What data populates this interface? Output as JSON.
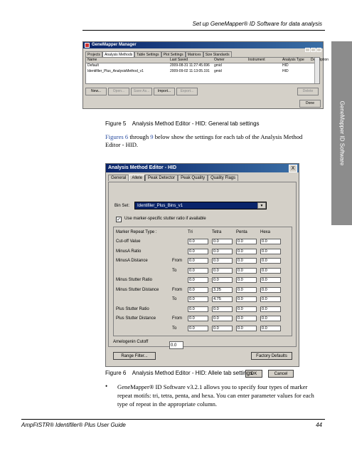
{
  "page": {
    "header": "Set up GeneMapper® ID Software for data analysis",
    "side_tab": "GeneMapper ID Software",
    "footer_left": "AmpFℓSTR® Identifiler® Plus User Guide",
    "footer_right": "44"
  },
  "manager": {
    "title": "GeneMapper Manager",
    "tabs": [
      "Projects",
      "Analysis Methods",
      "Table Settings",
      "Plot Settings",
      "Matrices",
      "Size Standards"
    ],
    "columns": [
      "Name",
      "Last Saved",
      "Owner",
      "Instrument",
      "Analysis Type",
      "Description"
    ],
    "rows": [
      [
        "Default",
        "2009-08-31 11:27:45.696",
        "gmid",
        "",
        "HID",
        ""
      ],
      [
        "Identifiler_Plus_AnalysisMethod_v1",
        "2009-09-02 11:13:05.191",
        "gmid",
        "",
        "HID",
        ""
      ]
    ],
    "buttons": [
      "New...",
      "Open...",
      "Save As...",
      "Import...",
      "Export...",
      "Delete"
    ],
    "done": "Done"
  },
  "figure5_caption": "Figure 5    Analysis Method Editor - HID: General tab settings",
  "para1": {
    "a": "Figures 6",
    "b": " through ",
    "c": "9",
    "d": " below show the settings for each tab of the Analysis Method Editor - HID."
  },
  "editor": {
    "title": "Analysis Method Editor - HID",
    "close": "X",
    "tabs": [
      "General",
      "Allele",
      "Peak Detector",
      "Peak Quality",
      "Quality Flags"
    ],
    "bin_set_label": "Bin Set:",
    "bin_set_value": "Identifiler_Plus_Bins_v1",
    "checkbox_label": "Use marker-specific stutter ratio if available",
    "checkbox_checked": "✓",
    "header_label": "Marker Repeat Type :",
    "col_heads": [
      "Tri",
      "Tetra",
      "Penta",
      "Hexa"
    ],
    "rows": [
      {
        "label": "Cut-off Value",
        "sub": "",
        "vals": [
          "0.0",
          "0.0",
          "0.0",
          "0.0"
        ]
      },
      {
        "label": "MinusA Ratio",
        "sub": "",
        "vals": [
          "0.0",
          "0.0",
          "0.0",
          "0.0"
        ]
      },
      {
        "label": "MinusA Distance",
        "sub": "From",
        "vals": [
          "0.0",
          "0.0",
          "0.0",
          "0.0"
        ]
      },
      {
        "label": "",
        "sub": "To",
        "vals": [
          "0.0",
          "0.0",
          "0.0",
          "0.0"
        ]
      },
      {
        "label": "Minus Stutter Ratio",
        "sub": "",
        "vals": [
          "0.0",
          "0.0",
          "0.0",
          "0.0"
        ]
      },
      {
        "label": "Minus Stutter Distance",
        "sub": "From",
        "vals": [
          "0.0",
          "3.25",
          "0.0",
          "0.0"
        ]
      },
      {
        "label": "",
        "sub": "To",
        "vals": [
          "0.0",
          "4.75",
          "0.0",
          "0.0"
        ]
      },
      {
        "label": "Plus Stutter Ratio",
        "sub": "",
        "vals": [
          "0.0",
          "0.0",
          "0.0",
          "0.0"
        ]
      },
      {
        "label": "Plus Stutter Distance",
        "sub": "From",
        "vals": [
          "0.0",
          "0.0",
          "0.0",
          "0.0"
        ]
      },
      {
        "label": "",
        "sub": "To",
        "vals": [
          "0.0",
          "0.0",
          "0.0",
          "0.0"
        ]
      }
    ],
    "amelogenin_label": "Amelogenin Cutoff",
    "amelogenin_value": "0.0",
    "range_filter": "Range Filter...",
    "factory_defaults": "Factory Defaults",
    "ok": "OK",
    "cancel": "Cancel"
  },
  "figure6_caption": "Figure 6    Analysis Method Editor - HID: Allele tab settings",
  "bullet": {
    "mark": "•",
    "text": "GeneMapper® ID Software v3.2.1 allows you to specify four types of marker repeat motifs: tri, tetra, penta, and hexa. You can enter parameter values for each type of repeat in the appropriate column."
  }
}
